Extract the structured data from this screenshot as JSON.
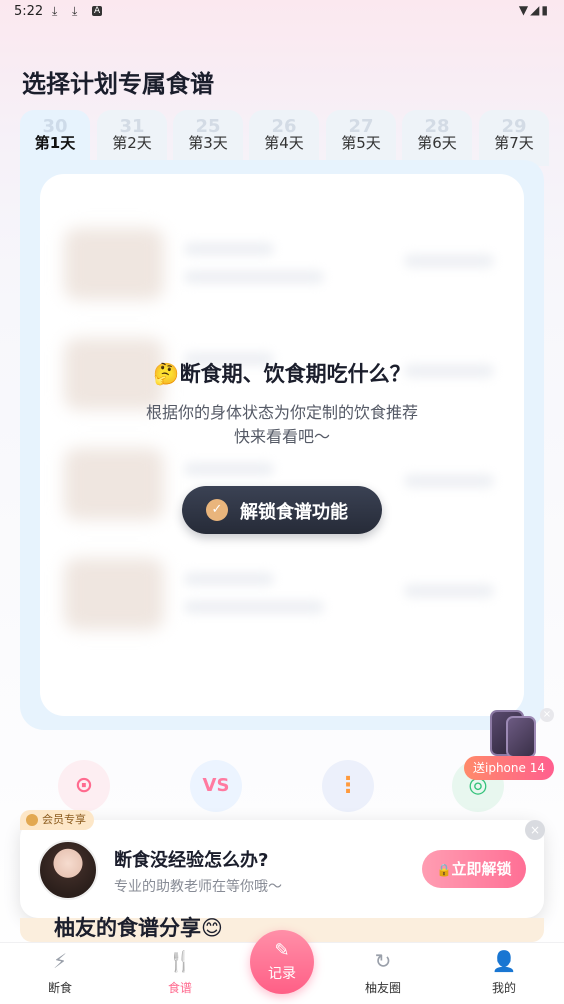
{
  "status_bar": {
    "time": "5:22",
    "left_icons": [
      "download-icon",
      "download-icon",
      "app-icon"
    ],
    "right_icons": [
      "wifi-icon",
      "signal-icon",
      "battery-icon"
    ]
  },
  "page_title": "选择计划专属食谱",
  "days": [
    {
      "label": "第1天",
      "ghost": "30",
      "active": true
    },
    {
      "label": "第2天",
      "ghost": "31"
    },
    {
      "label": "第3天",
      "ghost": "25"
    },
    {
      "label": "第4天",
      "ghost": "26"
    },
    {
      "label": "第5天",
      "ghost": "27"
    },
    {
      "label": "第6天",
      "ghost": "28"
    },
    {
      "label": "第7天",
      "ghost": "29"
    }
  ],
  "locked": {
    "emoji": "🤔",
    "title": "断食期、饮食期吃什么？",
    "subtitle_line1": "根据你的身体状态为你定制的饮食推荐",
    "subtitle_line2": "快来看看吧～",
    "button": "解锁食谱功能"
  },
  "tools": [
    {
      "icon": "magnifier-icon",
      "glyph": "⊙",
      "color": "#ff6b8f",
      "bg": "#fdeef2"
    },
    {
      "icon": "versus-icon",
      "glyph": "VS",
      "color": "#ff7aa0",
      "bg": "#ecf4ff"
    },
    {
      "icon": "traffic-light-icon",
      "glyph": "⋮",
      "color": "#ff9a3c",
      "bg": "#ecf0fb"
    },
    {
      "icon": "camera-icon",
      "glyph": "◎",
      "color": "#33c27a",
      "bg": "#e8f7ef"
    }
  ],
  "promo": {
    "label": "送iphone 14"
  },
  "member": {
    "tag": "会员专享",
    "title": "断食没经验怎么办?",
    "subtitle": "专业的助教老师在等你哦～",
    "button": "立即解锁",
    "lock_glyph": "🔒"
  },
  "share_title": "柚友的食谱分享😊",
  "tabbar": [
    {
      "label": "断食",
      "icon": "lightning-icon",
      "glyph": "⚡"
    },
    {
      "label": "食谱",
      "icon": "fork-knife-icon",
      "glyph": "🍴",
      "active": true
    },
    {
      "label": "柚友圈",
      "icon": "refresh-icon",
      "glyph": "↻"
    },
    {
      "label": "我的",
      "icon": "user-icon",
      "glyph": "👤"
    }
  ],
  "record": {
    "label": "记录",
    "glyph": "✎"
  }
}
